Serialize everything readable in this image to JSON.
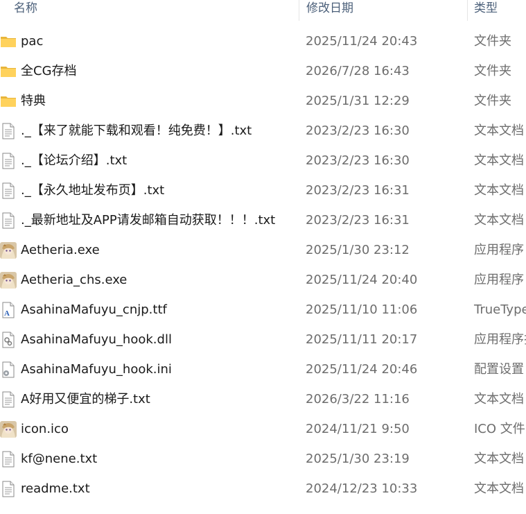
{
  "columns": {
    "name": "名称",
    "date": "修改日期",
    "type": "类型"
  },
  "files": [
    {
      "name": "pac",
      "date": "2025/11/24 20:43",
      "type": "文件夹",
      "icon": "folder-icon"
    },
    {
      "name": "全CG存档",
      "date": "2026/7/28 16:43",
      "type": "文件夹",
      "icon": "folder-icon"
    },
    {
      "name": "特典",
      "date": "2025/1/31 12:29",
      "type": "文件夹",
      "icon": "folder-icon"
    },
    {
      "name": "._【来了就能下载和观看！纯免费！】.txt",
      "date": "2023/2/23 16:30",
      "type": "文本文档",
      "icon": "text-file-icon"
    },
    {
      "name": "._【论坛介绍】.txt",
      "date": "2023/2/23 16:30",
      "type": "文本文档",
      "icon": "text-file-icon"
    },
    {
      "name": "._【永久地址发布页】.txt",
      "date": "2023/2/23 16:31",
      "type": "文本文档",
      "icon": "text-file-icon"
    },
    {
      "name": "._最新地址及APP请发邮箱自动获取！！！.txt",
      "date": "2023/2/23 16:31",
      "type": "文本文档",
      "icon": "text-file-icon"
    },
    {
      "name": "Aetheria.exe",
      "date": "2025/1/30 23:12",
      "type": "应用程序",
      "icon": "app-character-icon"
    },
    {
      "name": "Aetheria_chs.exe",
      "date": "2025/11/24 20:40",
      "type": "应用程序",
      "icon": "app-character-icon"
    },
    {
      "name": "AsahinaMafuyu_cnjp.ttf",
      "date": "2025/11/10 11:06",
      "type": "TrueType",
      "icon": "font-file-icon"
    },
    {
      "name": "AsahinaMafuyu_hook.dll",
      "date": "2025/11/11 20:17",
      "type": "应用程序扩",
      "icon": "dll-file-icon"
    },
    {
      "name": "AsahinaMafuyu_hook.ini",
      "date": "2025/11/24 20:46",
      "type": "配置设置",
      "icon": "config-file-icon"
    },
    {
      "name": "A好用又便宜的梯子.txt",
      "date": "2026/3/22 11:16",
      "type": "文本文档",
      "icon": "text-file-icon"
    },
    {
      "name": "icon.ico",
      "date": "2024/11/21 9:50",
      "type": "ICO 文件",
      "icon": "app-character-icon"
    },
    {
      "name": "kf@nene.txt",
      "date": "2025/1/30 23:19",
      "type": "文本文档",
      "icon": "text-file-icon"
    },
    {
      "name": "readme.txt",
      "date": "2024/12/23 10:33",
      "type": "文本文档",
      "icon": "text-file-icon"
    }
  ]
}
